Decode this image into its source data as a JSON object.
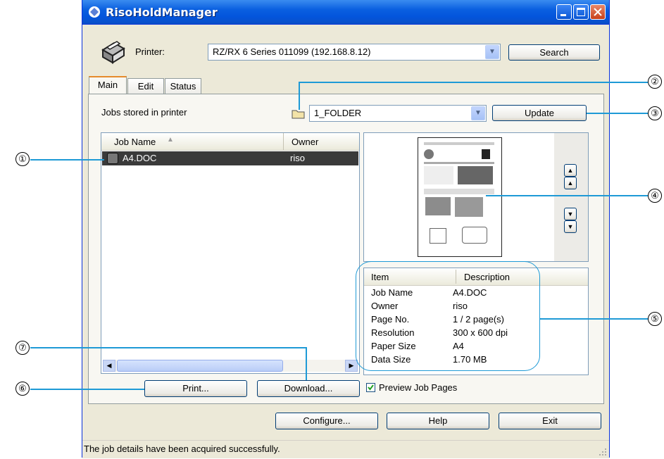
{
  "window": {
    "title": "RisoHoldManager"
  },
  "printer": {
    "label": "Printer:",
    "selected": "RZ/RX 6 Series 011099 (192.168.8.12)",
    "search_label": "Search"
  },
  "tabs": [
    {
      "label": "Main"
    },
    {
      "label": "Edit"
    },
    {
      "label": "Status"
    }
  ],
  "jobs": {
    "stored_label": "Jobs stored in printer",
    "folder": "1_FOLDER",
    "update_label": "Update",
    "columns": [
      "Job Name",
      "Owner"
    ],
    "rows": [
      {
        "name": "A4.DOC",
        "owner": "riso"
      }
    ]
  },
  "details": {
    "columns": [
      "Item",
      "Description"
    ],
    "rows": [
      {
        "item": "Job Name",
        "desc": "A4.DOC"
      },
      {
        "item": "Owner",
        "desc": "riso"
      },
      {
        "item": "Page No.",
        "desc": "1 / 2 page(s)"
      },
      {
        "item": "Resolution",
        "desc": "300 x 600 dpi"
      },
      {
        "item": "Paper Size",
        "desc": "A4"
      },
      {
        "item": "Data Size",
        "desc": "1.70 MB"
      }
    ]
  },
  "actions": {
    "print_label": "Print...",
    "download_label": "Download...",
    "preview_label": "Preview Job Pages",
    "preview_checked": true
  },
  "footer": {
    "configure_label": "Configure...",
    "help_label": "Help",
    "exit_label": "Exit"
  },
  "status": {
    "text": "The job details have been acquired successfully."
  },
  "callouts": [
    "①",
    "②",
    "③",
    "④",
    "⑤",
    "⑥",
    "⑦"
  ],
  "colors": {
    "title_bar": "#0a5fe0",
    "selection": "#3a3a3a",
    "callout_line": "#1e9ad6"
  }
}
